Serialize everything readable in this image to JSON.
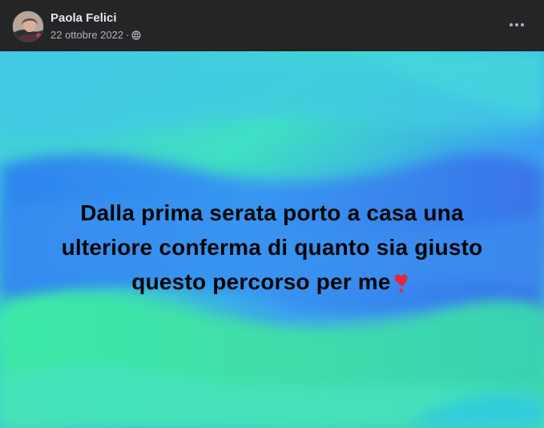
{
  "post": {
    "author": "Paola Felici",
    "date": "22 ottobre 2022",
    "separator": "·",
    "privacy_icon": "globe-icon",
    "more_icon": "more-horizontal-icon",
    "text_lines": [
      "Dalla prima serata porto a casa una",
      "ulteriore conferma di quanto sia giusto",
      "questo percorso per me"
    ],
    "emoji_icon": "heart-exclamation-icon"
  },
  "colors": {
    "header_bg": "#242526",
    "name": "#e4e6eb",
    "meta": "#b0b3b8",
    "text": "#050505",
    "background_teal": "#46d8d0",
    "background_blue": "#2f8ff0",
    "background_green": "#3fe39d",
    "heart": "#e7263a"
  }
}
